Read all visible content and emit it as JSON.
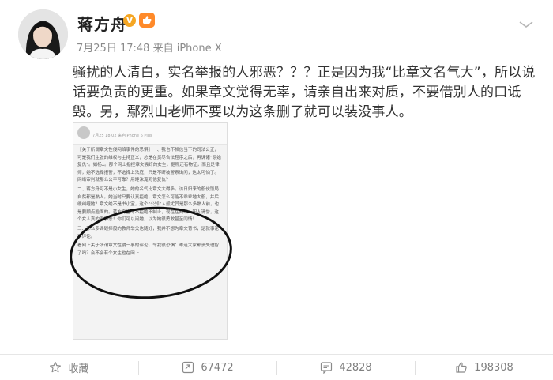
{
  "post": {
    "author": "蒋方舟",
    "verified_badge": "V",
    "date": "7月25日",
    "time": "17:48",
    "source": "来自 iPhone X",
    "text": "骚扰的人清白，实名举报的人邪恶？？？正是因为我“比章文名气大”，所以说话要负责的更重。如果章文觉得无辜，请亲自出来对质，不要借别人的口诋毁。另，鄢烈山老师不要以为这条删了就可以装没事人。"
  },
  "embedded_screenshot": {
    "time_line": "7月25 18:02 来自iPhone 6 Plus",
    "para1": "【关于所谓章文性侵网络事件的恐惧】一、我也不相信当下的司法公正，可是我们主张的维权与主持正义，总是在货尽合法程序之后，再诉诸“原始复仇”。如杨x。那个网上指控章文强奸的女生，据称还有物证，而且是律师，她不选择报警，不选择上法庭，只是不断被警察询问，这太可怕了。网络审判就那么公平可靠？用睡沫淹死他复仇？",
    "para2": "二、蒋方舟可不是小女生，她的名气比章文大得多。访日归来的般伙饭局自然都是熟人。她当时只要认真拒绝，章文怎么可能不乖乖地大般，并后缓纠缠她？章文绝不是书小宝，这个“公知”人般尤其是那么多熟人前，也是要顾点脸面的。蒋方舟当时不拒绝不制止，现在在网络上因人清誉，这个女人真的很邪恶！你们可以问她，以为她很勇敢甚至同情！",
    "para3": "三、那么多谗毁捧般的教师举父也随好，我并不想为章文背书，是就事论事评论。",
    "para4": "看网上关于所谓章文性侵一事的评论，令我很恐惧：难道大家都丧失理智了吗？会不会有个女生也在网上"
  },
  "actions": {
    "favorite_label": "收藏",
    "repost_count": "67472",
    "comment_count": "42828",
    "like_count": "198308"
  },
  "icons": {
    "more": "more-icon",
    "favorite": "star-icon",
    "repost": "repost-icon",
    "comment": "comment-icon",
    "like": "thumbs-up-icon"
  },
  "colors": {
    "text": "#333333",
    "meta": "#8a8a8a",
    "verified": "#f5a623"
  }
}
